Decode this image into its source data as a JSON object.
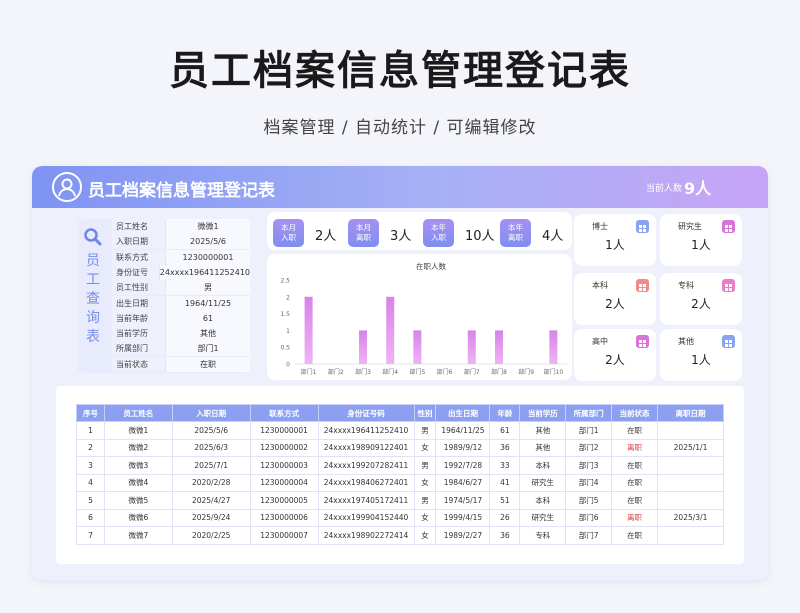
{
  "header": {
    "title": "员工档案信息管理登记表",
    "subtitle": "档案管理 / 自动统计 /  可编辑修改"
  },
  "banner": {
    "title": "员工档案信息管理登记表",
    "count_label": "当前人数",
    "count_value": "9人"
  },
  "query": {
    "side_label": "员\n工\n查\n询\n表",
    "rows": [
      {
        "k": "员工姓名",
        "v": "微微1"
      },
      {
        "k": "入职日期",
        "v": "2025/5/6"
      },
      {
        "k": "联系方式",
        "v": "1230000001"
      },
      {
        "k": "身份证号",
        "v": "24xxxx196411252410"
      },
      {
        "k": "员工性别",
        "v": "男"
      },
      {
        "k": "出生日期",
        "v": "1964/11/25"
      },
      {
        "k": "当前年龄",
        "v": "61"
      },
      {
        "k": "当前学历",
        "v": "其他"
      },
      {
        "k": "所属部门",
        "v": "部门1"
      },
      {
        "k": "当前状态",
        "v": "在职"
      }
    ]
  },
  "stats": [
    {
      "tag": "本月\n入职",
      "value": "2人"
    },
    {
      "tag": "本月\n离职",
      "value": "3人"
    },
    {
      "tag": "本年\n入职",
      "value": "10人"
    },
    {
      "tag": "本年\n离职",
      "value": "4人"
    }
  ],
  "chart_data": {
    "type": "bar",
    "title": "在职人数",
    "categories": [
      "部门1",
      "部门2",
      "部门3",
      "部门4",
      "部门5",
      "部门6",
      "部门7",
      "部门8",
      "部门9",
      "部门10"
    ],
    "values": [
      2,
      0,
      1,
      2,
      1,
      0,
      1,
      1,
      0,
      1
    ],
    "yticks": [
      "0",
      "0.5",
      "1",
      "1.5",
      "2",
      "2.5"
    ],
    "ylim": [
      0,
      2.5
    ],
    "grid": false,
    "color_top": "#d883ea",
    "color_bottom": "#f0b3f3"
  },
  "degrees": [
    {
      "label": "博士",
      "value": "1人",
      "color": "#8aa3f0"
    },
    {
      "label": "研究生",
      "value": "1人",
      "color": "#d873d8"
    },
    {
      "label": "本科",
      "value": "2人",
      "color": "#f08a8a"
    },
    {
      "label": "专科",
      "value": "2人",
      "color": "#e97ec4"
    },
    {
      "label": "高中",
      "value": "2人",
      "color": "#d873d8"
    },
    {
      "label": "其他",
      "value": "1人",
      "color": "#8aa3f0"
    }
  ],
  "table": {
    "headers": [
      "序号",
      "员工姓名",
      "入职日期",
      "联系方式",
      "身份证号码",
      "性别",
      "出生日期",
      "年龄",
      "当前学历",
      "所属部门",
      "当前状态",
      "离职日期"
    ],
    "rows": [
      [
        "1",
        "微微1",
        "2025/5/6",
        "1230000001",
        "24xxxx196411252410",
        "男",
        "1964/11/25",
        "61",
        "其他",
        "部门1",
        "在职",
        ""
      ],
      [
        "2",
        "微微2",
        "2025/6/3",
        "1230000002",
        "24xxxx198909122401",
        "女",
        "1989/9/12",
        "36",
        "其他",
        "部门2",
        "离职",
        "2025/1/1"
      ],
      [
        "3",
        "微微3",
        "2025/7/1",
        "1230000003",
        "24xxxx199207282411",
        "男",
        "1992/7/28",
        "33",
        "本科",
        "部门3",
        "在职",
        ""
      ],
      [
        "4",
        "微微4",
        "2020/2/28",
        "1230000004",
        "24xxxx198406272401",
        "女",
        "1984/6/27",
        "41",
        "研究生",
        "部门4",
        "在职",
        ""
      ],
      [
        "5",
        "微微5",
        "2025/4/27",
        "1230000005",
        "24xxxx197405172411",
        "男",
        "1974/5/17",
        "51",
        "本科",
        "部门5",
        "在职",
        ""
      ],
      [
        "6",
        "微微6",
        "2025/9/24",
        "1230000006",
        "24xxxx199904152440",
        "女",
        "1999/4/15",
        "26",
        "研究生",
        "部门6",
        "离职",
        "2025/3/1"
      ],
      [
        "7",
        "微微7",
        "2020/2/25",
        "1230000007",
        "24xxxx198902272414",
        "女",
        "1989/2/27",
        "36",
        "专科",
        "部门7",
        "在职",
        ""
      ]
    ],
    "leave_color": "#e23b3b"
  }
}
